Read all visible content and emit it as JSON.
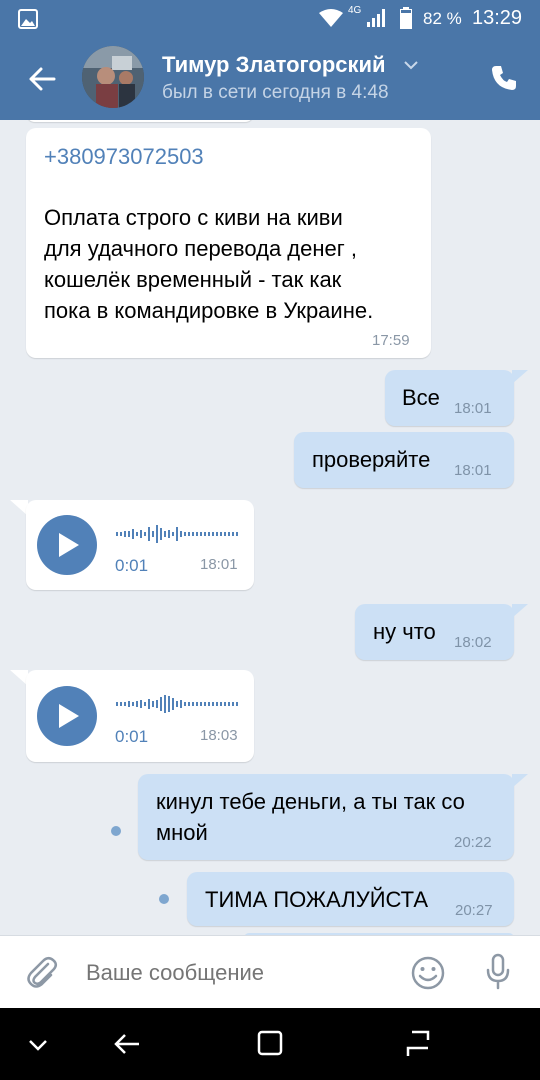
{
  "status": {
    "battery": "82 %",
    "time": "13:29",
    "network": "4G"
  },
  "header": {
    "name": "Тимур Златогорский",
    "subtitle": "был в сети сегодня в 4:48"
  },
  "messages": {
    "m1": {
      "phone": "+380973072503",
      "lines": [
        "Оплата строго с киви на киви",
        "для удачного перевода денег ,",
        "кошелёк временный - так как",
        "пока в командировке в Украине."
      ],
      "time": "17:59"
    },
    "m2": {
      "text": "Все",
      "time": "18:01"
    },
    "m3": {
      "text": "проверяйте",
      "time": "18:01"
    },
    "m4": {
      "duration": "0:01",
      "time": "18:01"
    },
    "m5": {
      "text": "ну что",
      "time": "18:02"
    },
    "m6": {
      "duration": "0:01",
      "time": "18:03"
    },
    "m7": {
      "lines": [
        "кинул тебе деньги, а ты так со",
        "мной"
      ],
      "time": "20:22"
    },
    "m8": {
      "text": "ТИМА ПОЖАЛУЙСТА",
      "time": "20:27"
    }
  },
  "composer": {
    "placeholder": "Ваше сообщение"
  },
  "colors": {
    "brand": "#4a76a8",
    "outgoing": "#cce0f5",
    "background": "#e9edf2",
    "accent": "#5181b8"
  }
}
